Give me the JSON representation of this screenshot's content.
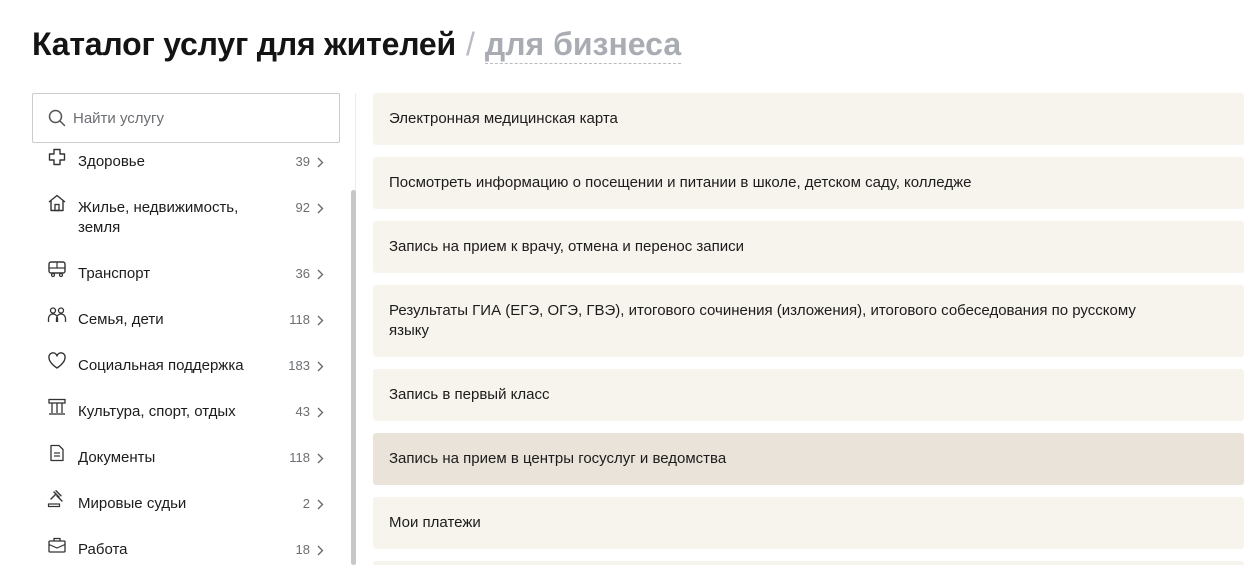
{
  "header": {
    "title": "Каталог услуг для жителей",
    "separator": "/",
    "alt_link": "для бизнеса"
  },
  "search": {
    "placeholder": "Найти услугу",
    "icon": "search-icon"
  },
  "categories": [
    {
      "label": "Здоровье",
      "count": "39",
      "icon": "health-cross-icon"
    },
    {
      "label": "Жилье, недвижимость, земля",
      "count": "92",
      "icon": "house-icon"
    },
    {
      "label": "Транспорт",
      "count": "36",
      "icon": "bus-icon"
    },
    {
      "label": "Семья, дети",
      "count": "118",
      "icon": "family-icon"
    },
    {
      "label": "Социальная поддержка",
      "count": "183",
      "icon": "heart-icon"
    },
    {
      "label": "Культура, спорт, отдых",
      "count": "43",
      "icon": "museum-icon"
    },
    {
      "label": "Документы",
      "count": "118",
      "icon": "document-icon"
    },
    {
      "label": "Мировые судьи",
      "count": "2",
      "icon": "gavel-icon"
    },
    {
      "label": "Работа",
      "count": "18",
      "icon": "briefcase-icon"
    }
  ],
  "services": [
    {
      "label": "Электронная медицинская карта"
    },
    {
      "label": "Посмотреть информацию о посещении и питании в школе, детском саду, колледже"
    },
    {
      "label": "Запись на прием к врачу, отмена и перенос записи"
    },
    {
      "label": "Результаты ГИА (ЕГЭ, ОГЭ, ГВЭ), итогового сочинения (изложения), итогового собеседования по русскому языку"
    },
    {
      "label": "Запись в первый класс"
    },
    {
      "label": "Запись на прием в центры госуслуг и ведомства",
      "active": true
    },
    {
      "label": "Мои платежи"
    }
  ],
  "colors": {
    "card_bg": "#f7f4ee",
    "card_active_bg": "#e9e3da",
    "title_alt": "#a9adb3"
  }
}
